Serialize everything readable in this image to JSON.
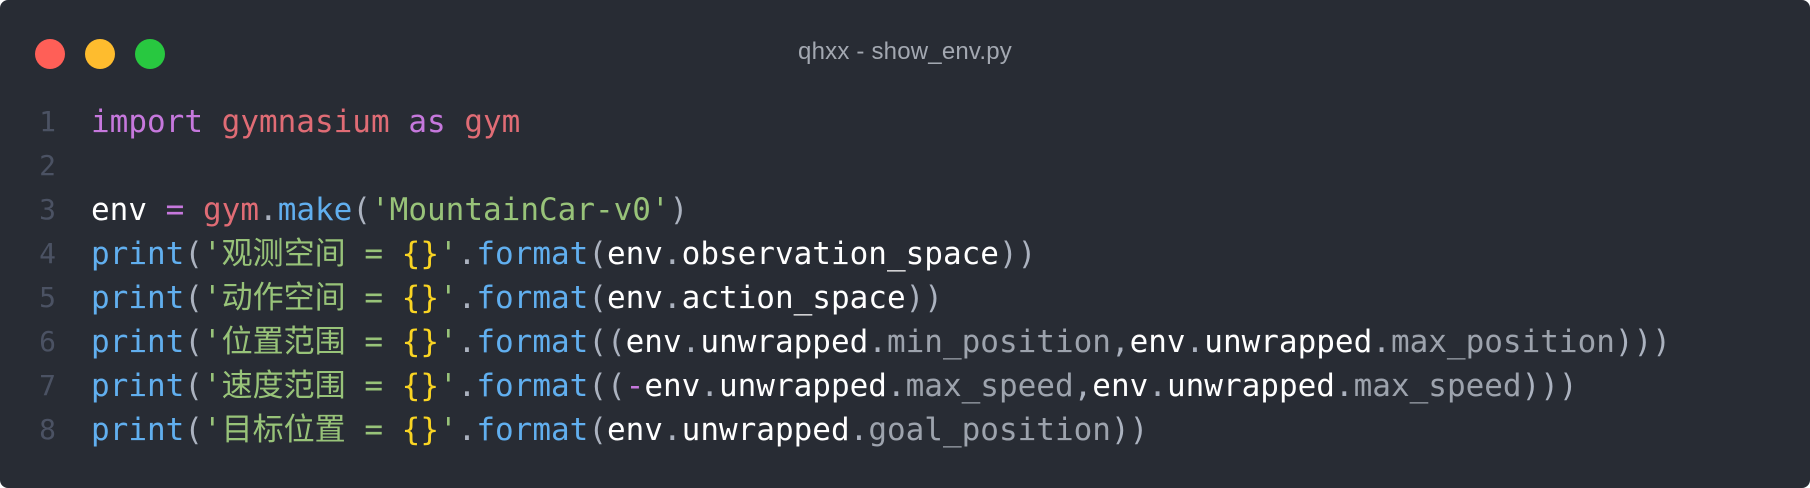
{
  "window": {
    "title": "qhxx - show_env.py",
    "controls": [
      "close",
      "minimize",
      "maximize"
    ],
    "colors": {
      "background": "#282c34",
      "close": "#ff5f57",
      "minimize": "#febc2e",
      "maximize": "#28c840"
    }
  },
  "editor": {
    "lines": [
      {
        "number": "1",
        "tokens": [
          {
            "text": "import",
            "type": "keyword"
          },
          {
            "text": " ",
            "type": "plain"
          },
          {
            "text": "gymnasium",
            "type": "module"
          },
          {
            "text": " ",
            "type": "plain"
          },
          {
            "text": "as",
            "type": "keyword"
          },
          {
            "text": " ",
            "type": "plain"
          },
          {
            "text": "gym",
            "type": "module"
          }
        ]
      },
      {
        "number": "2",
        "tokens": []
      },
      {
        "number": "3",
        "tokens": [
          {
            "text": "env",
            "type": "plain"
          },
          {
            "text": " ",
            "type": "plain"
          },
          {
            "text": "=",
            "type": "operator"
          },
          {
            "text": " ",
            "type": "plain"
          },
          {
            "text": "gym",
            "type": "module"
          },
          {
            "text": ".",
            "type": "punct"
          },
          {
            "text": "make",
            "type": "func"
          },
          {
            "text": "(",
            "type": "punct"
          },
          {
            "text": "'MountainCar-v0'",
            "type": "string"
          },
          {
            "text": ")",
            "type": "punct"
          }
        ]
      },
      {
        "number": "4",
        "tokens": [
          {
            "text": "print",
            "type": "func"
          },
          {
            "text": "(",
            "type": "punct"
          },
          {
            "text": "'观测空间 = ",
            "type": "string"
          },
          {
            "text": "{}",
            "type": "brace"
          },
          {
            "text": "'",
            "type": "string"
          },
          {
            "text": ".",
            "type": "punct"
          },
          {
            "text": "format",
            "type": "func"
          },
          {
            "text": "(",
            "type": "punct"
          },
          {
            "text": "env",
            "type": "plain"
          },
          {
            "text": ".",
            "type": "punct"
          },
          {
            "text": "observation_space",
            "type": "plain"
          },
          {
            "text": "))",
            "type": "punct"
          }
        ]
      },
      {
        "number": "5",
        "tokens": [
          {
            "text": "print",
            "type": "func"
          },
          {
            "text": "(",
            "type": "punct"
          },
          {
            "text": "'动作空间 = ",
            "type": "string"
          },
          {
            "text": "{}",
            "type": "brace"
          },
          {
            "text": "'",
            "type": "string"
          },
          {
            "text": ".",
            "type": "punct"
          },
          {
            "text": "format",
            "type": "func"
          },
          {
            "text": "(",
            "type": "punct"
          },
          {
            "text": "env",
            "type": "plain"
          },
          {
            "text": ".",
            "type": "punct"
          },
          {
            "text": "action_space",
            "type": "plain"
          },
          {
            "text": "))",
            "type": "punct"
          }
        ]
      },
      {
        "number": "6",
        "tokens": [
          {
            "text": "print",
            "type": "func"
          },
          {
            "text": "(",
            "type": "punct"
          },
          {
            "text": "'位置范围 = ",
            "type": "string"
          },
          {
            "text": "{}",
            "type": "brace"
          },
          {
            "text": "'",
            "type": "string"
          },
          {
            "text": ".",
            "type": "punct"
          },
          {
            "text": "format",
            "type": "func"
          },
          {
            "text": "((",
            "type": "punct"
          },
          {
            "text": "env",
            "type": "plain"
          },
          {
            "text": ".",
            "type": "punct"
          },
          {
            "text": "unwrapped",
            "type": "plain"
          },
          {
            "text": ".",
            "type": "punct"
          },
          {
            "text": "min_position",
            "type": "attr"
          },
          {
            "text": ",",
            "type": "punct"
          },
          {
            "text": "env",
            "type": "plain"
          },
          {
            "text": ".",
            "type": "punct"
          },
          {
            "text": "unwrapped",
            "type": "plain"
          },
          {
            "text": ".",
            "type": "punct"
          },
          {
            "text": "max_position",
            "type": "attr"
          },
          {
            "text": ")))",
            "type": "punct"
          }
        ]
      },
      {
        "number": "7",
        "tokens": [
          {
            "text": "print",
            "type": "func"
          },
          {
            "text": "(",
            "type": "punct"
          },
          {
            "text": "'速度范围 = ",
            "type": "string"
          },
          {
            "text": "{}",
            "type": "brace"
          },
          {
            "text": "'",
            "type": "string"
          },
          {
            "text": ".",
            "type": "punct"
          },
          {
            "text": "format",
            "type": "func"
          },
          {
            "text": "((",
            "type": "punct"
          },
          {
            "text": "-",
            "type": "operator"
          },
          {
            "text": "env",
            "type": "plain"
          },
          {
            "text": ".",
            "type": "punct"
          },
          {
            "text": "unwrapped",
            "type": "plain"
          },
          {
            "text": ".",
            "type": "punct"
          },
          {
            "text": "max_speed",
            "type": "attr"
          },
          {
            "text": ",",
            "type": "punct"
          },
          {
            "text": "env",
            "type": "plain"
          },
          {
            "text": ".",
            "type": "punct"
          },
          {
            "text": "unwrapped",
            "type": "plain"
          },
          {
            "text": ".",
            "type": "punct"
          },
          {
            "text": "max_speed",
            "type": "attr"
          },
          {
            "text": ")))",
            "type": "punct"
          }
        ]
      },
      {
        "number": "8",
        "tokens": [
          {
            "text": "print",
            "type": "func"
          },
          {
            "text": "(",
            "type": "punct"
          },
          {
            "text": "'目标位置 = ",
            "type": "string"
          },
          {
            "text": "{}",
            "type": "brace"
          },
          {
            "text": "'",
            "type": "string"
          },
          {
            "text": ".",
            "type": "punct"
          },
          {
            "text": "format",
            "type": "func"
          },
          {
            "text": "(",
            "type": "punct"
          },
          {
            "text": "env",
            "type": "plain"
          },
          {
            "text": ".",
            "type": "punct"
          },
          {
            "text": "unwrapped",
            "type": "plain"
          },
          {
            "text": ".",
            "type": "punct"
          },
          {
            "text": "goal_position",
            "type": "attr"
          },
          {
            "text": "))",
            "type": "punct"
          }
        ]
      }
    ]
  }
}
